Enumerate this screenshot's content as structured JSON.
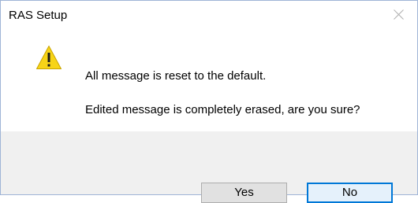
{
  "window": {
    "title": "RAS Setup",
    "close_icon": "close-icon"
  },
  "message": {
    "icon": "warning-icon",
    "line1": "All message is reset to the default.",
    "line2": "Edited message is completely erased, are you sure?"
  },
  "buttons": {
    "yes_label": "Yes",
    "no_label": "No"
  },
  "colors": {
    "warning_fill": "#f7d417",
    "default_button_border": "#0078d7",
    "footer_background": "#f0f0f0"
  }
}
